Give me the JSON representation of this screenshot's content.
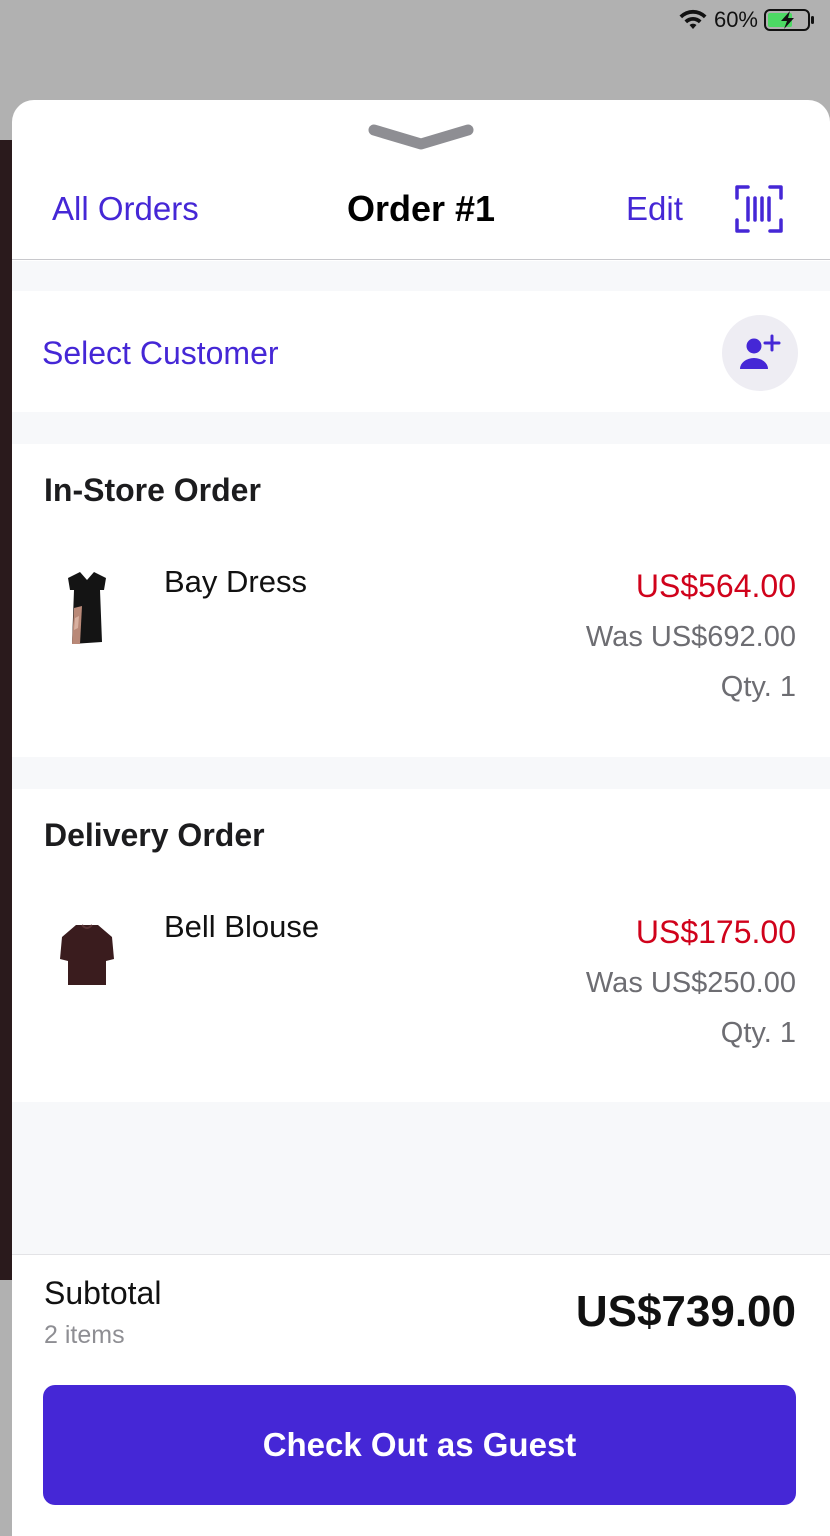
{
  "status_bar": {
    "battery_percent": "60%",
    "icons": [
      "wifi-icon",
      "battery-charging-icon"
    ]
  },
  "nav": {
    "back_label": "All Orders",
    "title": "Order #1",
    "edit_label": "Edit",
    "scan_icon": "barcode-scan-icon"
  },
  "customer": {
    "label": "Select Customer",
    "add_icon": "add-person-icon"
  },
  "orders": [
    {
      "title": "In-Store Order",
      "items": [
        {
          "name": "Bay Dress",
          "price": "US$564.00",
          "was": "Was US$692.00",
          "qty": "Qty. 1",
          "thumb_icon": "dress-thumbnail"
        }
      ]
    },
    {
      "title": "Delivery Order",
      "items": [
        {
          "name": "Bell Blouse",
          "price": "US$175.00",
          "was": "Was US$250.00",
          "qty": "Qty. 1",
          "thumb_icon": "blouse-thumbnail"
        }
      ]
    }
  ],
  "footer": {
    "subtotal_label": "Subtotal",
    "item_count": "2 items",
    "subtotal_amount": "US$739.00",
    "checkout_label": "Check Out as Guest"
  },
  "colors": {
    "accent": "#4527d6",
    "sale_price": "#d0021b",
    "muted_text": "#6d6d72"
  }
}
